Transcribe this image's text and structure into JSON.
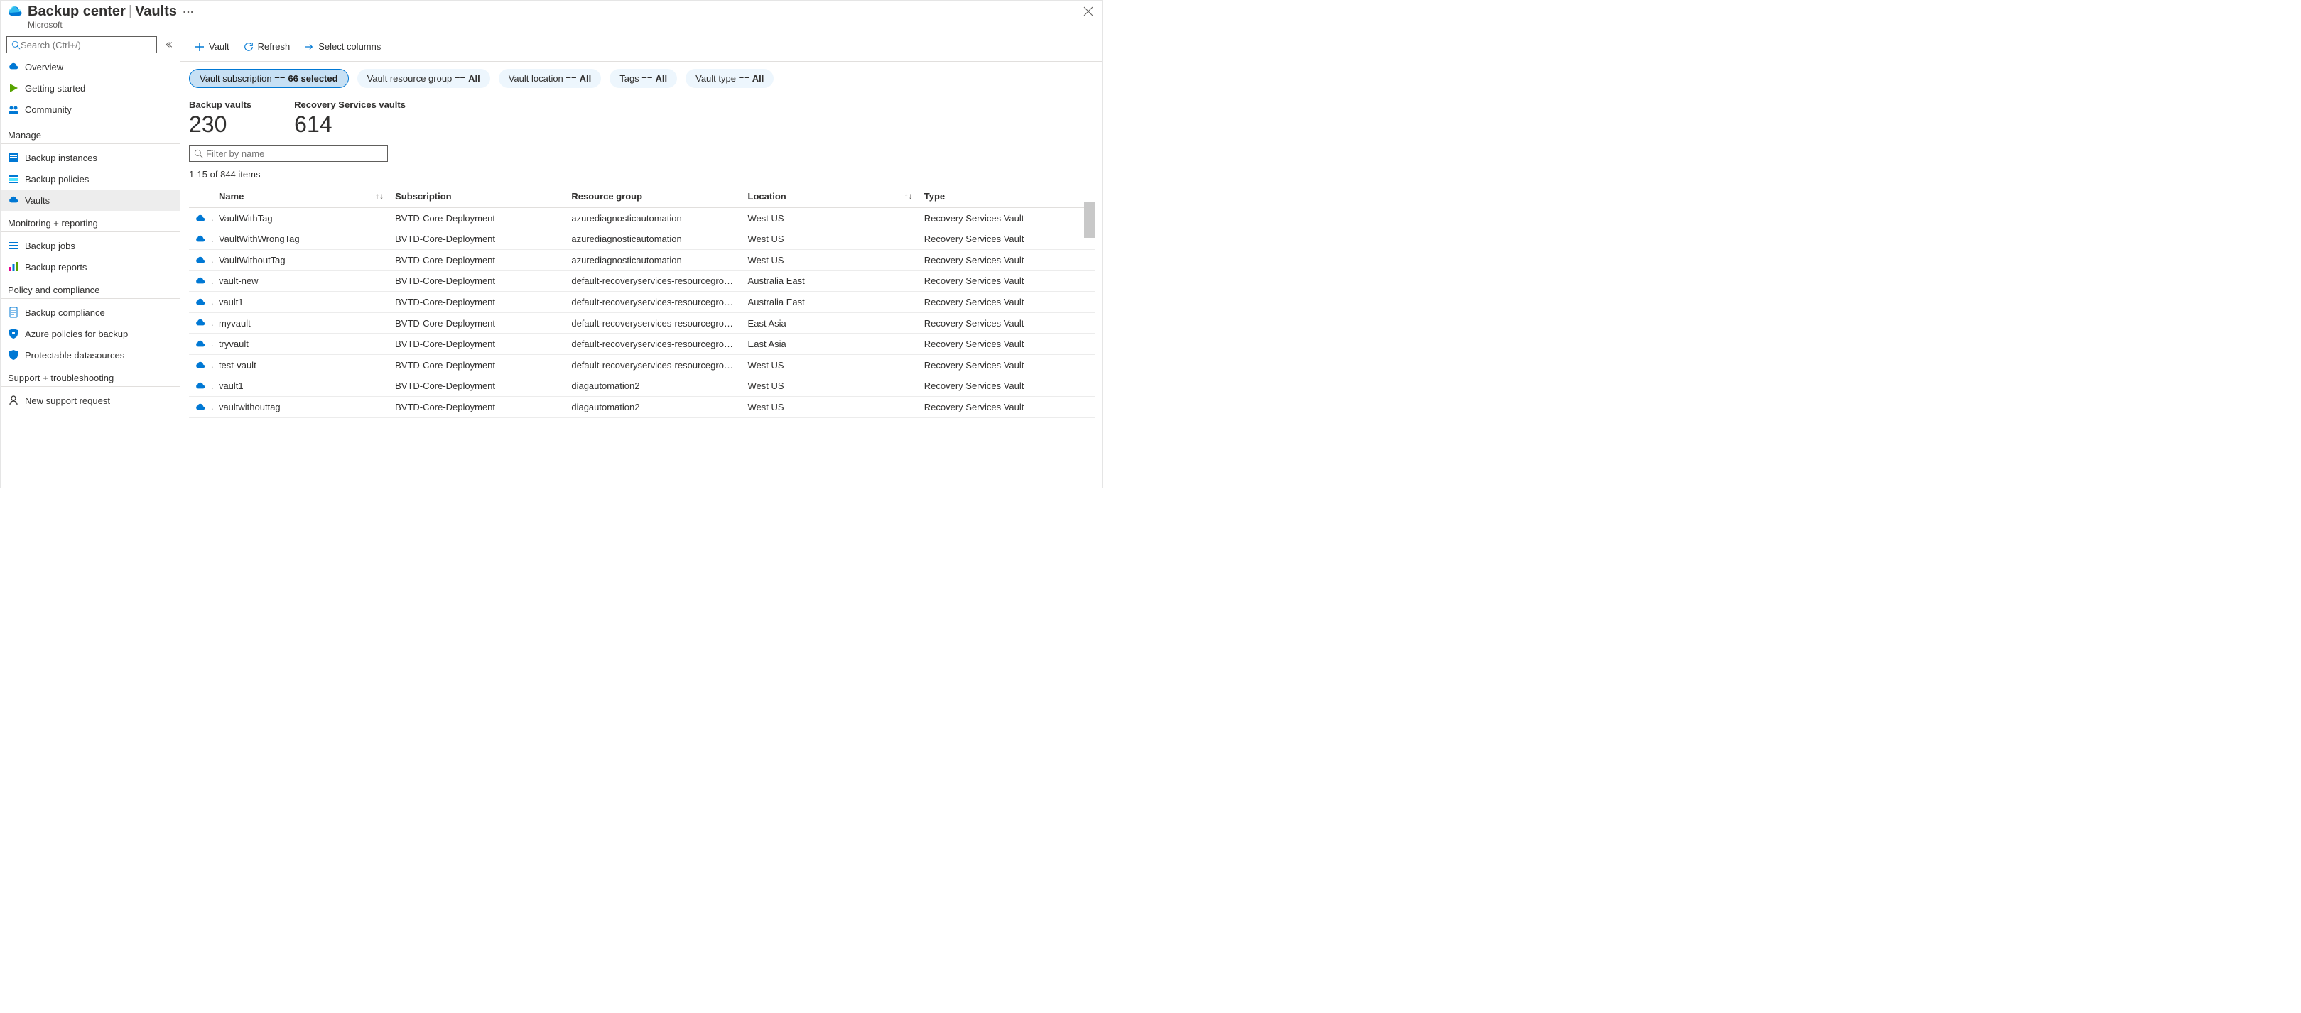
{
  "header": {
    "title_main": "Backup center",
    "title_sub": "Vaults",
    "subtitle": "Microsoft"
  },
  "search": {
    "placeholder": "Search (Ctrl+/)"
  },
  "nav": {
    "top": [
      {
        "id": "overview",
        "label": "Overview"
      },
      {
        "id": "getting-started",
        "label": "Getting started"
      },
      {
        "id": "community",
        "label": "Community"
      }
    ],
    "sections": [
      {
        "title": "Manage",
        "items": [
          {
            "id": "backup-instances",
            "label": "Backup instances"
          },
          {
            "id": "backup-policies",
            "label": "Backup policies"
          },
          {
            "id": "vaults",
            "label": "Vaults",
            "selected": true
          }
        ]
      },
      {
        "title": "Monitoring + reporting",
        "items": [
          {
            "id": "backup-jobs",
            "label": "Backup jobs"
          },
          {
            "id": "backup-reports",
            "label": "Backup reports"
          }
        ]
      },
      {
        "title": "Policy and compliance",
        "items": [
          {
            "id": "backup-compliance",
            "label": "Backup compliance"
          },
          {
            "id": "azure-policies",
            "label": "Azure policies for backup"
          },
          {
            "id": "protectable",
            "label": "Protectable datasources"
          }
        ]
      },
      {
        "title": "Support + troubleshooting",
        "items": [
          {
            "id": "new-support",
            "label": "New support request"
          }
        ]
      }
    ]
  },
  "toolbar": {
    "vault": "Vault",
    "refresh": "Refresh",
    "select_columns": "Select columns"
  },
  "filters": [
    {
      "label": "Vault subscription == ",
      "value": "66 selected",
      "active": true
    },
    {
      "label": "Vault resource group == ",
      "value": "All"
    },
    {
      "label": "Vault location == ",
      "value": "All"
    },
    {
      "label": "Tags == ",
      "value": "All"
    },
    {
      "label": "Vault type == ",
      "value": "All"
    }
  ],
  "summary": {
    "backup_vaults_label": "Backup vaults",
    "backup_vaults_value": "230",
    "recovery_services_label": "Recovery Services vaults",
    "recovery_services_value": "614"
  },
  "filter_input": {
    "placeholder": "Filter by name"
  },
  "count_line": "1-15 of 844 items",
  "columns": {
    "name": "Name",
    "subscription": "Subscription",
    "resource_group": "Resource group",
    "location": "Location",
    "type": "Type"
  },
  "rows": [
    {
      "name": "VaultWithTag",
      "sub": "BVTD-Core-Deployment",
      "rg": "azurediagnosticautomation",
      "loc": "West US",
      "type": "Recovery Services Vault"
    },
    {
      "name": "VaultWithWrongTag",
      "sub": "BVTD-Core-Deployment",
      "rg": "azurediagnosticautomation",
      "loc": "West US",
      "type": "Recovery Services Vault"
    },
    {
      "name": "VaultWithoutTag",
      "sub": "BVTD-Core-Deployment",
      "rg": "azurediagnosticautomation",
      "loc": "West US",
      "type": "Recovery Services Vault"
    },
    {
      "name": "vault-new",
      "sub": "BVTD-Core-Deployment",
      "rg": "default-recoveryservices-resourcegroup-…",
      "loc": "Australia East",
      "type": "Recovery Services Vault"
    },
    {
      "name": "vault1",
      "sub": "BVTD-Core-Deployment",
      "rg": "default-recoveryservices-resourcegroup-…",
      "loc": "Australia East",
      "type": "Recovery Services Vault"
    },
    {
      "name": "myvault",
      "sub": "BVTD-Core-Deployment",
      "rg": "default-recoveryservices-resourcegroup-…",
      "loc": "East Asia",
      "type": "Recovery Services Vault"
    },
    {
      "name": "tryvault",
      "sub": "BVTD-Core-Deployment",
      "rg": "default-recoveryservices-resourcegroup-…",
      "loc": "East Asia",
      "type": "Recovery Services Vault"
    },
    {
      "name": "test-vault",
      "sub": "BVTD-Core-Deployment",
      "rg": "default-recoveryservices-resourcegroup-…",
      "loc": "West US",
      "type": "Recovery Services Vault"
    },
    {
      "name": "vault1",
      "sub": "BVTD-Core-Deployment",
      "rg": "diagautomation2",
      "loc": "West US",
      "type": "Recovery Services Vault"
    },
    {
      "name": "vaultwithouttag",
      "sub": "BVTD-Core-Deployment",
      "rg": "diagautomation2",
      "loc": "West US",
      "type": "Recovery Services Vault"
    }
  ],
  "colors": {
    "link_blue": "#0078d4",
    "icon_blue": "#0078d4",
    "pill_active_bg": "#c7e0f4",
    "pill_bg": "#edf6fd"
  }
}
